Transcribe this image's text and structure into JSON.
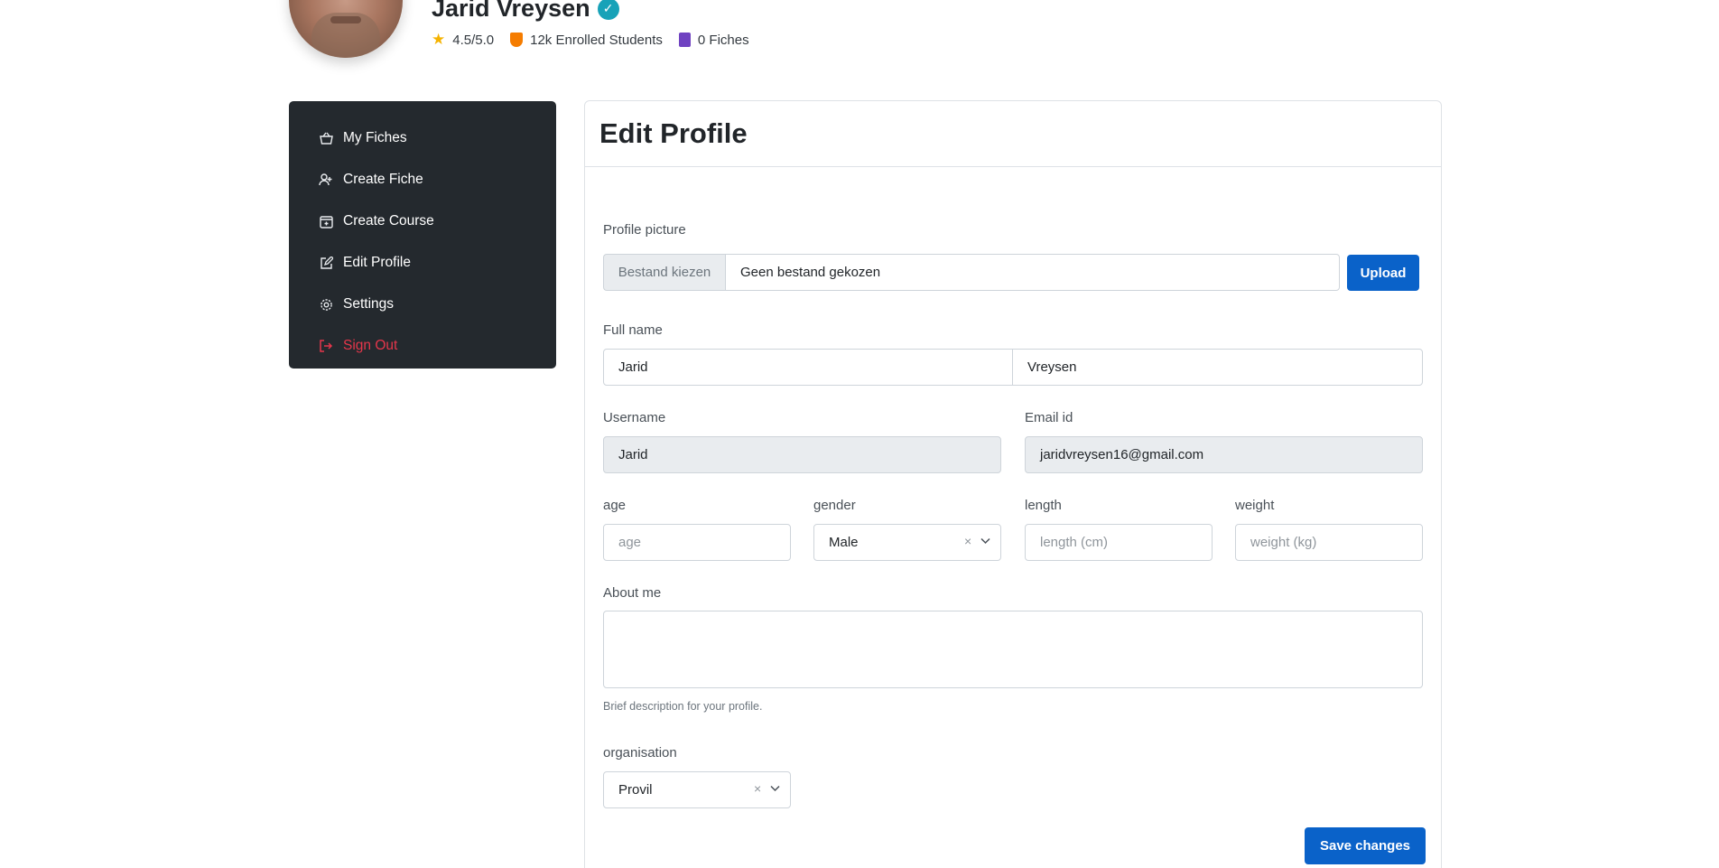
{
  "profile": {
    "name": "Jarid Vreysen",
    "rating": "4.5/5.0",
    "students": "12k Enrolled Students",
    "fiches": "0 Fiches"
  },
  "sidebar": {
    "items": [
      {
        "label": "My Fiches",
        "icon": "basket-icon"
      },
      {
        "label": "Create Fiche",
        "icon": "user-plus-icon"
      },
      {
        "label": "Create Course",
        "icon": "calendar-plus-icon"
      },
      {
        "label": "Edit Profile",
        "icon": "edit-icon"
      },
      {
        "label": "Settings",
        "icon": "gear-icon"
      },
      {
        "label": "Sign Out",
        "icon": "sign-out-icon"
      }
    ]
  },
  "form": {
    "title": "Edit Profile",
    "profile_picture_label": "Profile picture",
    "file_button": "Bestand kiezen",
    "file_name": "Geen bestand gekozen",
    "upload": "Upload",
    "full_name_label": "Full name",
    "first_name": "Jarid",
    "last_name": "Vreysen",
    "username_label": "Username",
    "username": "Jarid",
    "email_label": "Email id",
    "email": "jaridvreysen16@gmail.com",
    "age_label": "age",
    "age_placeholder": "age",
    "gender_label": "gender",
    "gender_value": "Male",
    "length_label": "length",
    "length_placeholder": "length (cm)",
    "weight_label": "weight",
    "weight_placeholder": "weight (kg)",
    "about_label": "About me",
    "about_help": "Brief description for your profile.",
    "organisation_label": "organisation",
    "organisation_value": "Provil",
    "save": "Save changes"
  },
  "colors": {
    "sidebar_bg": "#24292e",
    "primary": "#0a62c9",
    "danger": "#e5364b",
    "verified": "#17a2b8"
  }
}
